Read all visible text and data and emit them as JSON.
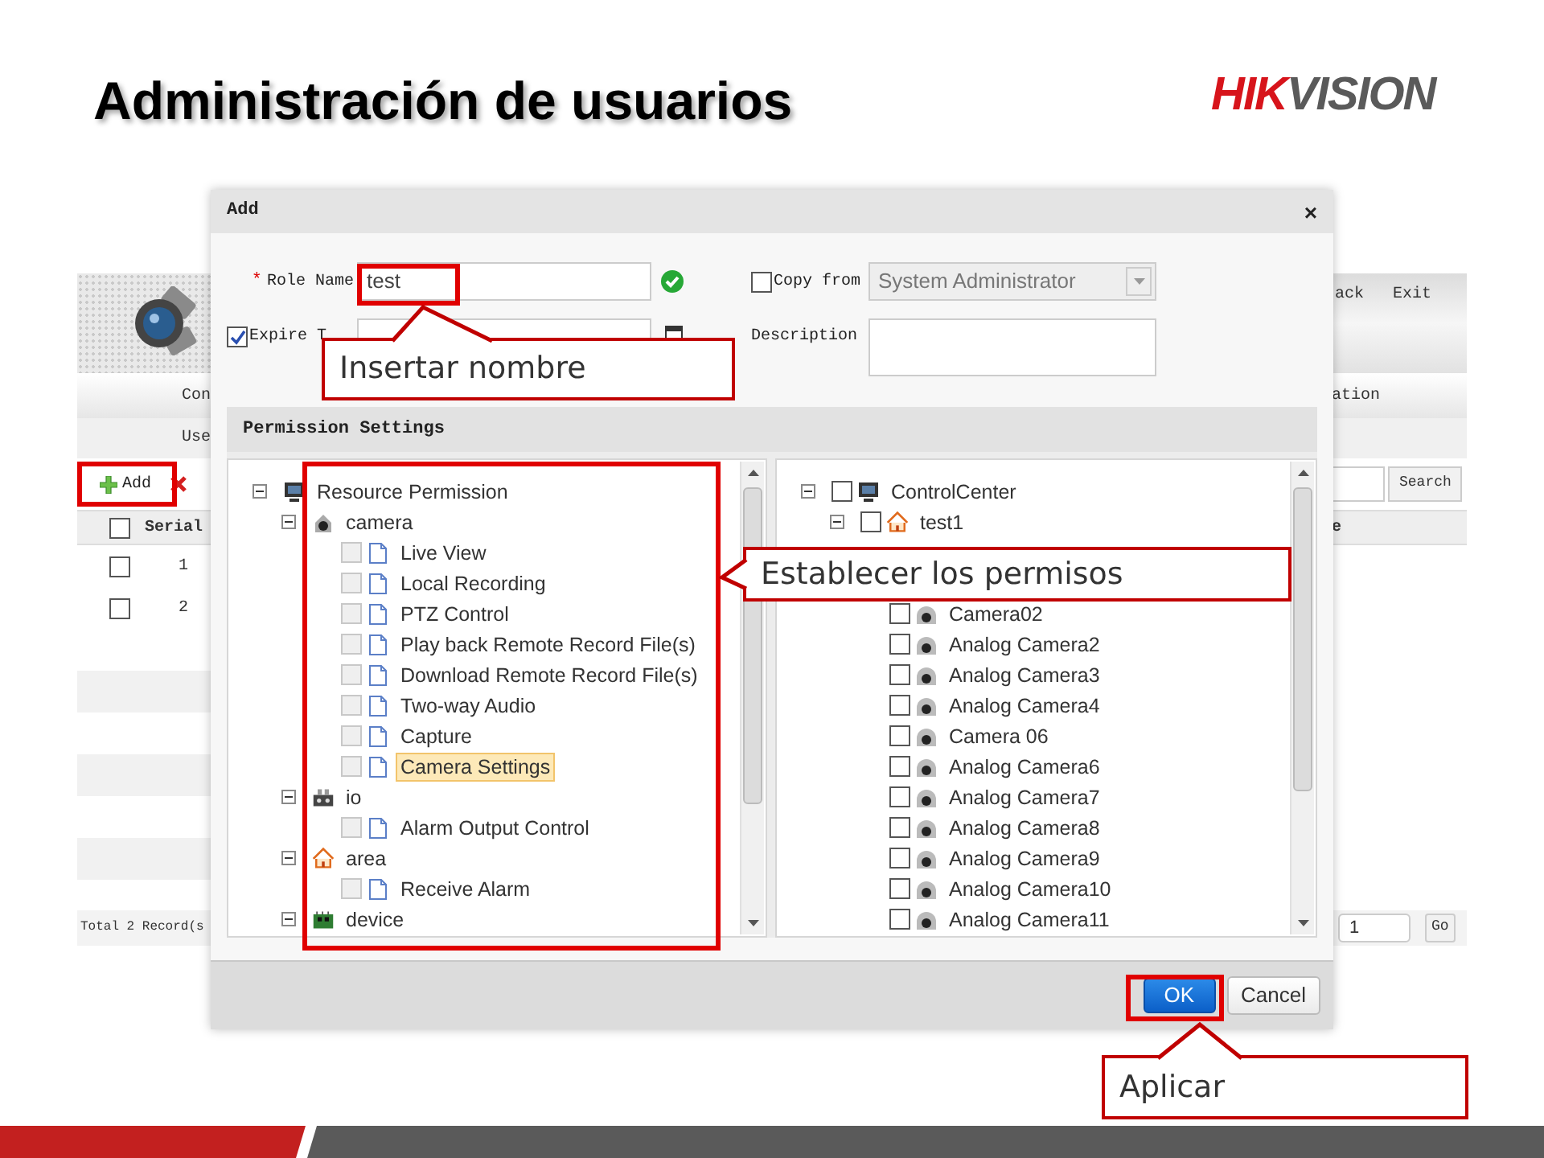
{
  "slide": {
    "title": "Administración de usuarios",
    "logo": {
      "part_1": "HIK",
      "part_2": "VISION"
    }
  },
  "background_app": {
    "top_links": [
      "ack",
      "Exit"
    ],
    "nav_left": "Con",
    "nav_right": "ation",
    "sub_nav": "Use",
    "toolbar": {
      "add": "Add"
    },
    "search_button": "Search",
    "table": {
      "header_checked": false,
      "columns": [
        "Serial",
        "e"
      ],
      "rows": [
        {
          "checked": false,
          "serial": "1"
        },
        {
          "checked": false,
          "serial": "2"
        }
      ]
    },
    "footer": "Total 2 Record(s",
    "page": "1",
    "go": "Go"
  },
  "dialog": {
    "title": "Add",
    "close": "×",
    "role_name": {
      "required": "*",
      "label": "Role Name",
      "value": "test",
      "valid": true
    },
    "expire": {
      "label": "Expire T",
      "checked": true
    },
    "copy_from": {
      "label": "Copy from",
      "checked": false,
      "value": "System Administrator"
    },
    "description": {
      "label": "Description"
    },
    "permission_settings": {
      "title": "Permission Settings",
      "trees": [
        [
          {
            "label": "Resource Permission",
            "kind": "monitor",
            "expanded": true,
            "children": [
              {
                "label": "camera",
                "kind": "camera",
                "expanded": true,
                "children": [
                  {
                    "label": "Live View",
                    "kind": "page",
                    "checked": false,
                    "selected": false
                  },
                  {
                    "label": "Local Recording",
                    "kind": "page",
                    "checked": false,
                    "selected": false
                  },
                  {
                    "label": "PTZ Control",
                    "kind": "page",
                    "checked": false,
                    "selected": false
                  },
                  {
                    "label": "Play back Remote Record File(s)",
                    "kind": "page",
                    "checked": false,
                    "selected": false
                  },
                  {
                    "label": "Download Remote Record File(s)",
                    "kind": "page",
                    "checked": false,
                    "selected": false
                  },
                  {
                    "label": "Two-way Audio",
                    "kind": "page",
                    "checked": false,
                    "selected": false
                  },
                  {
                    "label": "Capture",
                    "kind": "page",
                    "checked": false,
                    "selected": false
                  },
                  {
                    "label": "Camera Settings",
                    "kind": "page",
                    "checked": false,
                    "selected": true
                  }
                ]
              },
              {
                "label": "io",
                "kind": "io",
                "expanded": true,
                "children": [
                  {
                    "label": "Alarm Output Control",
                    "kind": "page",
                    "checked": false,
                    "selected": false
                  }
                ]
              },
              {
                "label": "area",
                "kind": "area",
                "expanded": true,
                "children": [
                  {
                    "label": "Receive Alarm",
                    "kind": "page",
                    "checked": false,
                    "selected": false
                  }
                ]
              },
              {
                "label": "device",
                "kind": "device",
                "expanded": true
              }
            ]
          }
        ],
        [
          {
            "label": "ControlCenter",
            "kind": "monitor",
            "expanded": true,
            "checked": false,
            "children": [
              {
                "label": "test1",
                "kind": "area",
                "expanded": true,
                "checked": false,
                "children": [
                  {
                    "label": "Camera02",
                    "kind": "dome",
                    "checked": false
                  },
                  {
                    "label": "Analog Camera2",
                    "kind": "dome",
                    "checked": false
                  },
                  {
                    "label": "Analog Camera3",
                    "kind": "dome",
                    "checked": false
                  },
                  {
                    "label": "Analog Camera4",
                    "kind": "dome",
                    "checked": false
                  },
                  {
                    "label": "Camera 06",
                    "kind": "dome",
                    "checked": false
                  },
                  {
                    "label": "Analog Camera6",
                    "kind": "dome",
                    "checked": false
                  },
                  {
                    "label": "Analog Camera7",
                    "kind": "dome",
                    "checked": false
                  },
                  {
                    "label": "Analog Camera8",
                    "kind": "dome",
                    "checked": false
                  },
                  {
                    "label": "Analog Camera9",
                    "kind": "dome",
                    "checked": false
                  },
                  {
                    "label": "Analog Camera10",
                    "kind": "dome",
                    "checked": false
                  },
                  {
                    "label": "Analog Camera11",
                    "kind": "dome",
                    "checked": false
                  }
                ]
              }
            ]
          }
        ]
      ]
    },
    "buttons": {
      "ok": "OK",
      "cancel": "Cancel"
    }
  },
  "callouts": [
    "Insertar nombre",
    "Establecer los permisos",
    "Aplicar"
  ]
}
